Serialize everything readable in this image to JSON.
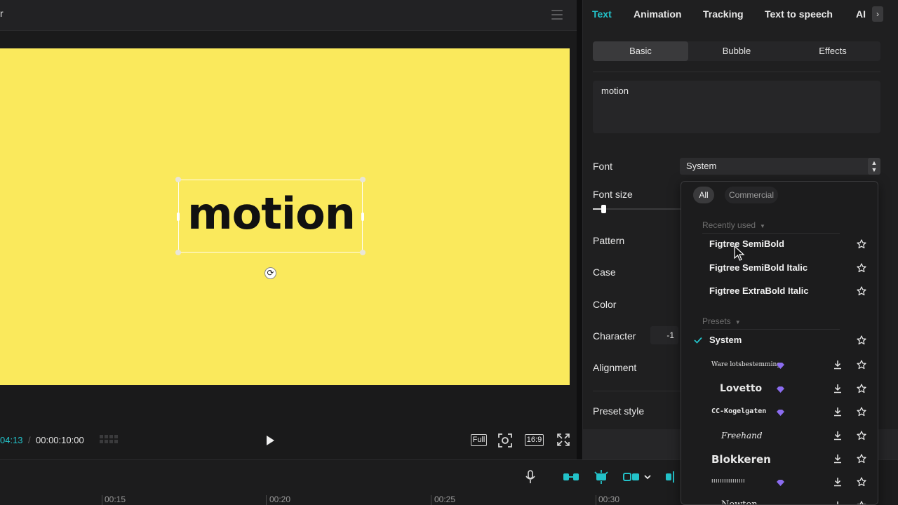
{
  "preview": {
    "title_fragment": "r",
    "canvas_text": "motion",
    "canvas_color": "#fae95c",
    "time_current": "04:13",
    "time_separator": "/",
    "time_total": "00:00:10:00",
    "full_label": "Full",
    "ratio_label": "16:9"
  },
  "timeline": {
    "ticks": [
      "00:15",
      "00:20",
      "00:25",
      "00:30"
    ]
  },
  "right_panel": {
    "tabs": [
      "Text",
      "Animation",
      "Tracking",
      "Text to speech",
      "AI"
    ],
    "subtabs": [
      "Basic",
      "Bubble",
      "Effects"
    ],
    "text_value": "motion",
    "labels": {
      "font": "Font",
      "font_size": "Font size",
      "pattern": "Pattern",
      "case": "Case",
      "color": "Color",
      "character": "Character",
      "alignment": "Alignment",
      "preset_style": "Preset style"
    },
    "font_value": "System",
    "character_value": "-1",
    "accent_color": "#23c2c9"
  },
  "font_dropdown": {
    "filters": [
      "All",
      "Commercial"
    ],
    "recently_used_header": "Recently used",
    "recently_used": [
      "Figtree SemiBold",
      "Figtree SemiBold Italic",
      "Figtree ExtraBold Italic"
    ],
    "presets_header": "Presets",
    "selected": "System",
    "presets": [
      {
        "name": "Ware lotsbestemming",
        "premium": true
      },
      {
        "name": "Lovetto",
        "premium": true
      },
      {
        "name": "CC-Kogelgaten",
        "premium": true
      },
      {
        "name": "Freehand",
        "premium": false
      },
      {
        "name": "Blokkeren",
        "premium": false
      },
      {
        "name": "ıııııııııııııııı",
        "premium": true
      },
      {
        "name": "Newton",
        "premium": false
      }
    ],
    "premium_color": "#8b6cf0"
  }
}
